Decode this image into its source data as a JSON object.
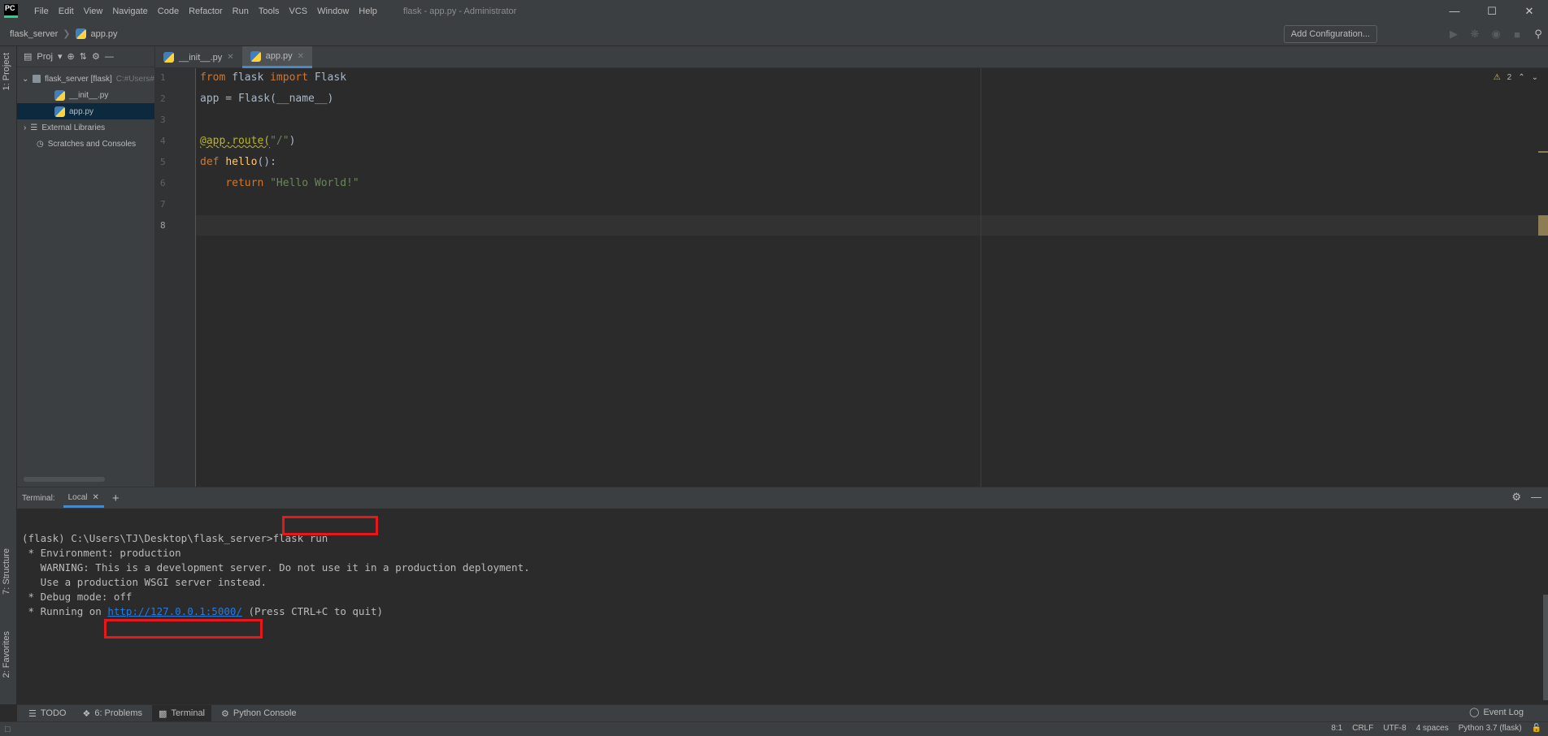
{
  "app": {
    "title": "flask - app.py - Administrator",
    "logo": "PC",
    "menu": [
      "File",
      "Edit",
      "View",
      "Navigate",
      "Code",
      "Refactor",
      "Run",
      "Tools",
      "VCS",
      "Window",
      "Help"
    ]
  },
  "navbar": {
    "crumbs": [
      "flask_server",
      "app.py"
    ],
    "add_config": "Add Configuration..."
  },
  "left_strip": {
    "project": "1: Project",
    "structure": "7: Structure",
    "favorites": "2: Favorites"
  },
  "project": {
    "header_label": "Proj",
    "root_name": "flask_server [flask]",
    "root_path": "C:#Users#",
    "files": [
      "__init__.py",
      "app.py"
    ],
    "external": "External Libraries",
    "scratches": "Scratches and Consoles"
  },
  "tabs": [
    "__init__.py",
    "app.py"
  ],
  "editor": {
    "lines": {
      "l1": {
        "num": "1",
        "kw1": "from",
        "mid": " flask ",
        "kw2": "import",
        "tail": " Flask"
      },
      "l2": {
        "num": "2",
        "text": "app = Flask(__name__)"
      },
      "l3": {
        "num": "3"
      },
      "l4": {
        "num": "4",
        "deco": "@app.route(",
        "str": "\"/\"",
        "close": ")"
      },
      "l5": {
        "num": "5",
        "kw": "def",
        "fn": "hello",
        "rest": "():"
      },
      "l6": {
        "num": "6",
        "kw": "return",
        "str": "\"Hello World!\""
      },
      "l7": {
        "num": "7"
      },
      "l8": {
        "num": "8"
      }
    },
    "warnings_count": "2"
  },
  "terminal": {
    "label": "Terminal:",
    "tab": "Local",
    "prompt": "(flask) C:\\Users\\TJ\\Desktop\\flask_server>",
    "command": "flask run",
    "output": [
      " * Environment: production",
      "   WARNING: This is a development server. Do not use it in a production deployment.",
      "   Use a production WSGI server instead.",
      " * Debug mode: off"
    ],
    "running_prefix": " * Running on ",
    "url": "http://127.0.0.1:5000/",
    "running_suffix": " (Press CTRL+C to quit)"
  },
  "toolwindows": {
    "todo": "TODO",
    "problems": "6: Problems",
    "terminal": "Terminal",
    "python_console": "Python Console",
    "event_log": "Event Log"
  },
  "status": {
    "position": "8:1",
    "line_sep": "CRLF",
    "encoding": "UTF-8",
    "indent": "4 spaces",
    "interpreter": "Python 3.7 (flask)"
  },
  "colors": {
    "highlight": "#e8171c",
    "accent": "#4a88c7",
    "keyword": "#cc7832",
    "string": "#6a8759"
  }
}
